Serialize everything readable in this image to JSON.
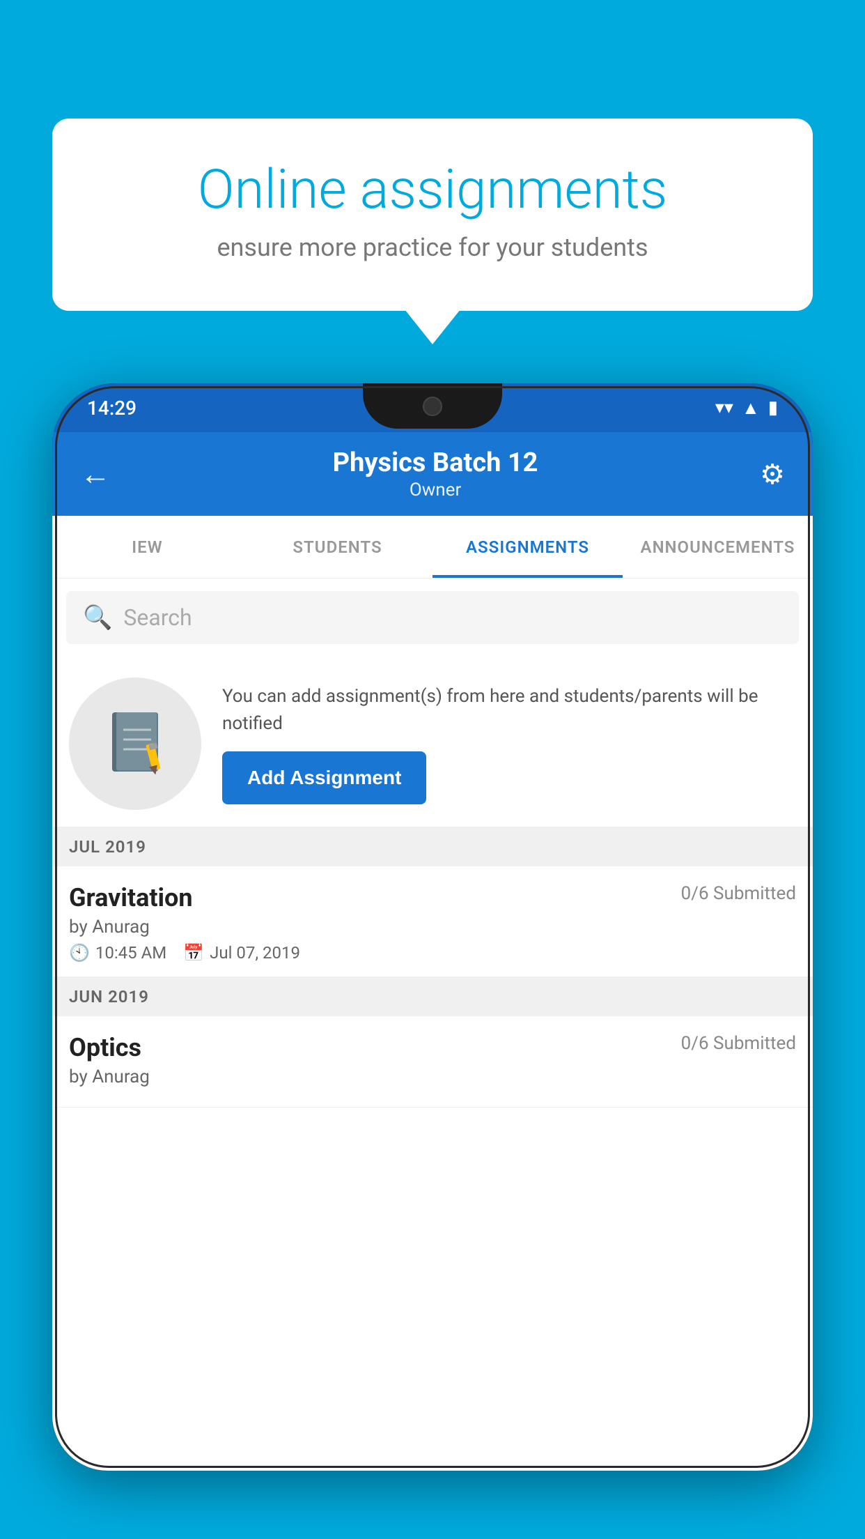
{
  "background_color": "#00AADD",
  "speech_bubble": {
    "title": "Online assignments",
    "subtitle": "ensure more practice for your students"
  },
  "status_bar": {
    "time": "14:29",
    "wifi": "▾",
    "signal": "▲",
    "battery": "▮"
  },
  "app_header": {
    "title": "Physics Batch 12",
    "subtitle": "Owner",
    "back_icon": "←",
    "settings_icon": "⚙"
  },
  "tabs": [
    {
      "label": "IEW",
      "active": false
    },
    {
      "label": "STUDENTS",
      "active": false
    },
    {
      "label": "ASSIGNMENTS",
      "active": true
    },
    {
      "label": "ANNOUNCEMENTS",
      "active": false
    }
  ],
  "search": {
    "placeholder": "Search"
  },
  "promo": {
    "text": "You can add assignment(s) from here and students/parents will be notified",
    "button_label": "Add Assignment"
  },
  "sections": [
    {
      "label": "JUL 2019",
      "assignments": [
        {
          "name": "Gravitation",
          "status": "0/6 Submitted",
          "author": "by Anurag",
          "time": "10:45 AM",
          "date": "Jul 07, 2019"
        }
      ]
    },
    {
      "label": "JUN 2019",
      "assignments": [
        {
          "name": "Optics",
          "status": "0/6 Submitted",
          "author": "by Anurag",
          "time": "",
          "date": ""
        }
      ]
    }
  ]
}
